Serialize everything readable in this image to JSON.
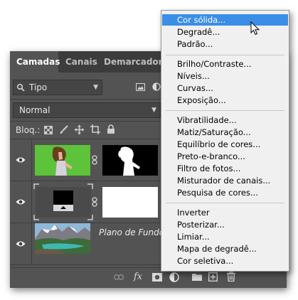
{
  "tabs": [
    "Camadas",
    "Canais",
    "Demarcadores"
  ],
  "filter": {
    "value": "Tipo"
  },
  "blend": {
    "value": "Normal"
  },
  "lock": {
    "label": "Bloq.:"
  },
  "layers": [
    {
      "name": "",
      "type": "photo-with-mask"
    },
    {
      "name": "",
      "type": "adjustment-with-mask"
    },
    {
      "name": "Plano de Fundo",
      "type": "background"
    }
  ],
  "bottom_icons": [
    "link-icon",
    "fx-icon",
    "mask-icon",
    "adjustment-icon",
    "folder-icon",
    "new-layer-icon",
    "trash-icon"
  ],
  "fx_label": "fx",
  "menu": {
    "groups": [
      [
        "Cor sólida...",
        "Degradê...",
        "Padrão..."
      ],
      [
        "Brilho/Contraste...",
        "Níveis...",
        "Curvas...",
        "Exposição..."
      ],
      [
        "Vibratilidade...",
        "Matiz/Saturação...",
        "Equilíbrio de cores...",
        "Preto-e-branco...",
        "Filtro de fotos...",
        "Misturador de canais...",
        "Pesquisa de cores..."
      ],
      [
        "Inverter",
        "Posterizar...",
        "Limiar...",
        "Mapa de degradê...",
        "Cor seletiva..."
      ]
    ],
    "highlighted": "Cor sólida..."
  },
  "colors": {
    "panel": "#535353",
    "menu_bg": "#f0f0f0",
    "highlight": "#3a8ee6",
    "green_screen": "#5cc33a"
  }
}
